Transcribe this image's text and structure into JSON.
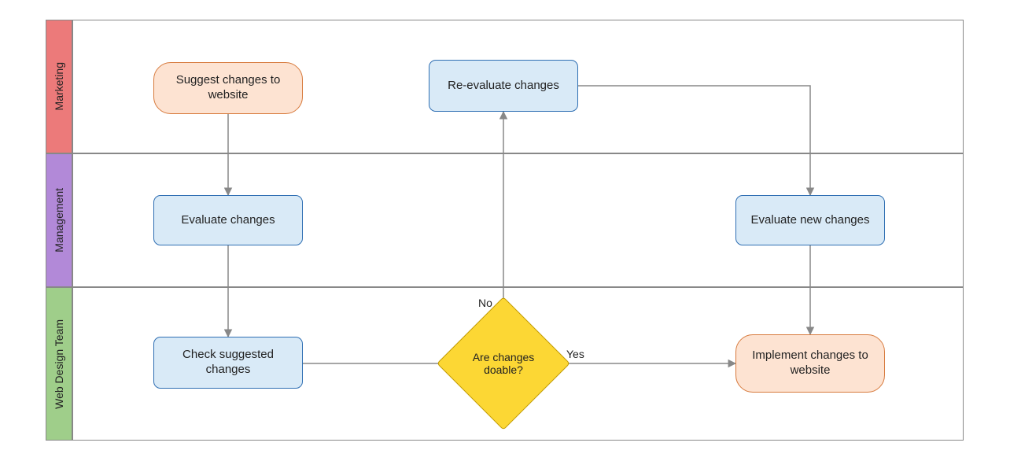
{
  "swimlanes": {
    "lane1": {
      "label": "Marketing",
      "fill": "#ec7a7a"
    },
    "lane2": {
      "label": "Management",
      "fill": "#b289d8"
    },
    "lane3": {
      "label": "Web Design Team",
      "fill": "#9fce8a"
    }
  },
  "nodes": {
    "suggest": {
      "label": "Suggest changes to website",
      "shape": "rounded-terminator",
      "style": "orange",
      "lane": "Marketing"
    },
    "evaluate": {
      "label": "Evaluate changes",
      "shape": "rounded-rect",
      "style": "blue",
      "lane": "Management"
    },
    "check": {
      "label": "Check suggested changes",
      "shape": "rounded-rect",
      "style": "blue",
      "lane": "Web Design Team"
    },
    "decision": {
      "label": "Are changes doable?",
      "shape": "diamond",
      "style": "yellow",
      "lane": "Web Design Team"
    },
    "reeval": {
      "label": "Re-evaluate changes",
      "shape": "rounded-rect",
      "style": "blue",
      "lane": "Marketing"
    },
    "evalnew": {
      "label": "Evaluate new changes",
      "shape": "rounded-rect",
      "style": "blue",
      "lane": "Management"
    },
    "implement": {
      "label": "Implement changes to website",
      "shape": "rounded-terminator",
      "style": "orange",
      "lane": "Web Design Team"
    }
  },
  "edges": {
    "e1": {
      "from": "suggest",
      "to": "evaluate",
      "label": ""
    },
    "e2": {
      "from": "evaluate",
      "to": "check",
      "label": ""
    },
    "e3": {
      "from": "check",
      "to": "decision",
      "label": ""
    },
    "e4": {
      "from": "decision",
      "to": "reeval",
      "label": "No"
    },
    "e5": {
      "from": "decision",
      "to": "implement",
      "label": "Yes"
    },
    "e6": {
      "from": "reeval",
      "to": "evalnew",
      "label": ""
    },
    "e7": {
      "from": "evalnew",
      "to": "implement",
      "label": ""
    }
  },
  "colors": {
    "blue_fill": "#d9eaf7",
    "blue_stroke": "#2f6fb3",
    "orange_fill": "#fde3d2",
    "orange_stroke": "#d77a3d",
    "yellow_fill": "#fcd734",
    "yellow_stroke": "#c19a00",
    "arrow": "#888888"
  }
}
